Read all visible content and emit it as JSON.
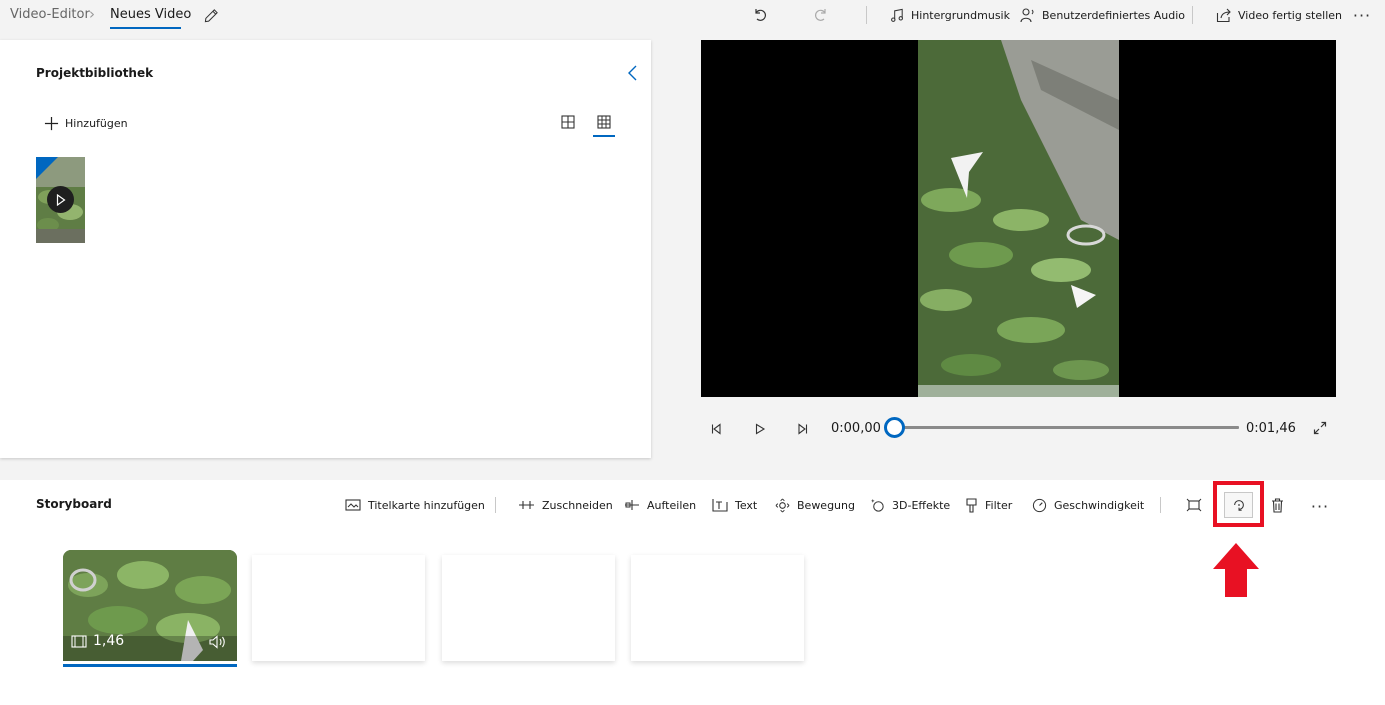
{
  "breadcrumb": {
    "root": "Video-Editor",
    "current": "Neues Video"
  },
  "toolbar": {
    "background_music": "Hintergrundmusik",
    "custom_audio": "Benutzerdefiniertes Audio",
    "finish_video": "Video fertig stellen"
  },
  "library": {
    "title": "Projektbibliothek",
    "add_label": "Hinzufügen"
  },
  "playback": {
    "current_time": "0:00,00",
    "total_time": "0:01,46",
    "progress": 0
  },
  "storyboard": {
    "title": "Storyboard",
    "actions": {
      "title_card": "Titelkarte hinzufügen",
      "trim": "Zuschneiden",
      "split": "Aufteilen",
      "text": "Text",
      "motion": "Bewegung",
      "effects_3d": "3D-Effekte",
      "filter": "Filter",
      "speed": "Geschwindigkeit"
    },
    "clips": [
      {
        "duration": "1,46"
      }
    ]
  },
  "colors": {
    "accent": "#0067c0",
    "highlight": "#e81123",
    "preview_bg": "#000000"
  },
  "icons": [
    "pencil-icon",
    "undo-icon",
    "redo-icon",
    "music-note-icon",
    "person-audio-icon",
    "share-icon",
    "more-icon",
    "chevron-left-icon",
    "plus-icon",
    "grid-large-icon",
    "grid-small-icon",
    "play-icon",
    "step-back-icon",
    "step-forward-icon",
    "fullscreen-icon",
    "title-card-icon",
    "trim-icon",
    "split-icon",
    "text-icon",
    "motion-icon",
    "effects-3d-icon",
    "filter-icon",
    "speed-icon",
    "resize-icon",
    "rotate-icon",
    "delete-icon",
    "film-icon",
    "volume-icon",
    "red-arrow-icon"
  ]
}
